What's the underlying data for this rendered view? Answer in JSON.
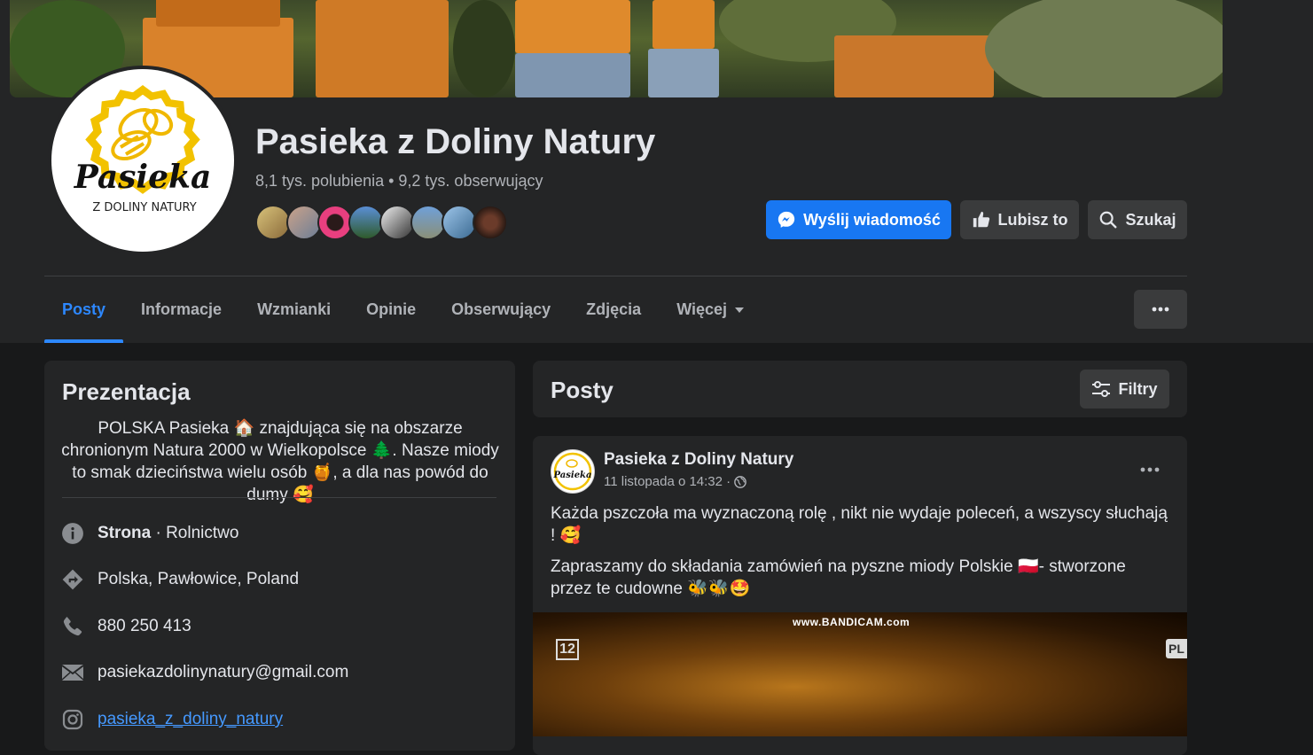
{
  "page": {
    "name": "Pasieka z Doliny Natury",
    "stats": "8,1 tys. polubienia • 9,2 tys. obserwujący",
    "logo_text_main": "Pasieka",
    "logo_text_sub": "Z DOLINY NATURY"
  },
  "actions": {
    "message_label": "Wyślij wiadomość",
    "like_label": "Lubisz to",
    "search_label": "Szukaj"
  },
  "tabs": [
    {
      "label": "Posty",
      "active": true
    },
    {
      "label": "Informacje"
    },
    {
      "label": "Wzmianki"
    },
    {
      "label": "Opinie"
    },
    {
      "label": "Obserwujący"
    },
    {
      "label": "Zdjęcia"
    },
    {
      "label": "Więcej"
    }
  ],
  "intro": {
    "title": "Prezentacja",
    "bio_1": "POLSKA Pasieka",
    "bio_2": " znajdująca się na obszarze chronionym Natura 2000 w Wielkopolsce",
    "bio_3": ". Nasze miody to smak dzieciństwa wielu osób",
    "bio_4": ", a dla nas powód do dumy",
    "category_bold": "Strona",
    "category_rest": " · Rolnictwo",
    "location": "Polska, Pawłowice, Poland",
    "phone": "880 250 413",
    "email": "pasiekazdolinynatury@gmail.com",
    "instagram": "pasieka_z_doliny_natury"
  },
  "posts_header": {
    "title": "Posty",
    "filter_label": "Filtry"
  },
  "post": {
    "author": "Pasieka z Doliny Natury",
    "time": "11 listopada o 14:32 ·",
    "text_1": "Każda pszczoła ma wyznaczoną rolę , nikt nie wydaje poleceń, a wszyscy słuchają !",
    "text_2a": "Zapraszamy do składania zamówień na pyszne miody  Polskie",
    "text_2b": "- stworzone przez te cudowne",
    "media_watermark": "www.BANDICAM.com",
    "media_badge": "12",
    "media_corner": "PL"
  },
  "colors": {
    "background": "#18191a",
    "surface": "#242526",
    "button": "#3a3b3c",
    "accent": "#1877f2",
    "active_tab": "#2d88ff",
    "link": "#4599ff"
  }
}
